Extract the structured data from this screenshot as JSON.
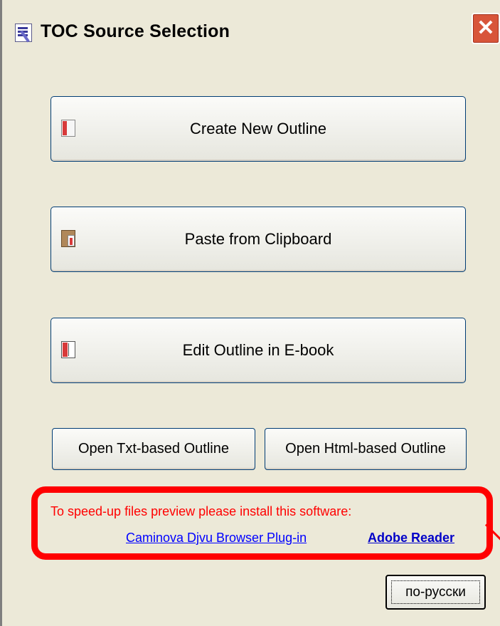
{
  "window": {
    "title": "TOC Source Selection",
    "close_label": "✕"
  },
  "main": {
    "buttons": [
      {
        "label": "Create New Outline",
        "icon": "new-outline-icon"
      },
      {
        "label": "Paste from Clipboard",
        "icon": "clipboard-icon"
      },
      {
        "label": "Edit Outline in E-book",
        "icon": "ebook-icon"
      }
    ],
    "open_txt_label": "Open Txt-based Outline",
    "open_html_label": "Open Html-based Outline"
  },
  "notice": {
    "text": "To speed-up files preview please install this software:",
    "links": [
      {
        "label": "Caminova Djvu Browser Plug-in"
      },
      {
        "label": "Adobe Reader"
      }
    ],
    "highlight_color": "#ff0000"
  },
  "footer": {
    "language_button": "по-русски"
  }
}
